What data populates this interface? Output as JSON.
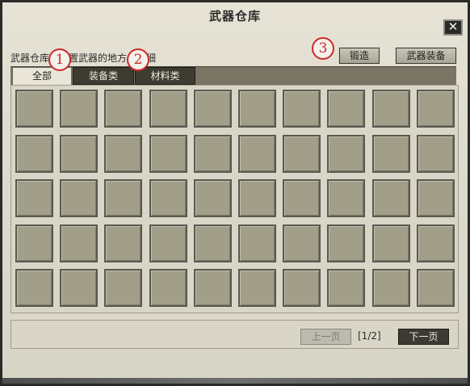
{
  "window": {
    "title": "武器仓库",
    "close_label": "✕"
  },
  "description": "武器仓库是放置武器的地方，详细",
  "buttons": {
    "forge": "锻造",
    "weapon_equip": "武器装备"
  },
  "callouts": [
    "1",
    "2",
    "3"
  ],
  "tabs": [
    "全部",
    "装备类",
    "材料类"
  ],
  "active_tab": 0,
  "grid": {
    "columns": 10,
    "rows": 5
  },
  "pagination": {
    "prev": "上一页",
    "indicator": "[1/2]",
    "next": "下一页"
  },
  "colors": {
    "slot": "#a19e8a",
    "panel": "#d9d6c8",
    "accent_red": "#cc2a2a"
  }
}
